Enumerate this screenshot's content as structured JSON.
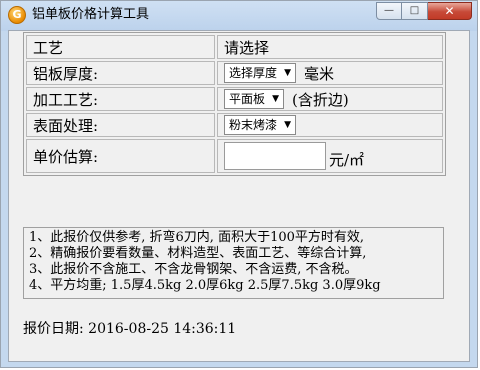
{
  "window": {
    "title": "铝单板价格计算工具",
    "app_icon_glyph": "G",
    "buttons": {
      "minimize": "—",
      "maximize": "□",
      "close": "✕"
    }
  },
  "form": {
    "process": {
      "label": "工艺",
      "value": "请选择"
    },
    "thickness": {
      "label": "铝板厚度:",
      "selected": "选择厚度",
      "unit": "毫米"
    },
    "fabrication": {
      "label": "加工工艺:",
      "selected": "平面板",
      "note": "(含折边)"
    },
    "surface": {
      "label": "表面处理:",
      "selected": "粉末烤漆"
    },
    "price": {
      "label": "单价估算:",
      "value": "",
      "unit": "元/㎡"
    }
  },
  "notes": [
    "1、此报价仅供参考, 折弯6刀内, 面积大于100平方时有效,",
    "2、精确报价要看数量、材料造型、表面工艺、等综合计算,",
    "3、此报价不含施工、不含龙骨钢架、不含运费, 不含税。",
    "4、平方均重; 1.5厚4.5kg 2.0厚6kg 2.5厚7.5kg 3.0厚9kg"
  ],
  "date": {
    "label": "报价日期:",
    "value": "2016-08-25 14:36:11"
  },
  "colors": {
    "titlebar": "#c4d8ee",
    "client": "#f0f0f0",
    "close_button": "#c74a38"
  }
}
